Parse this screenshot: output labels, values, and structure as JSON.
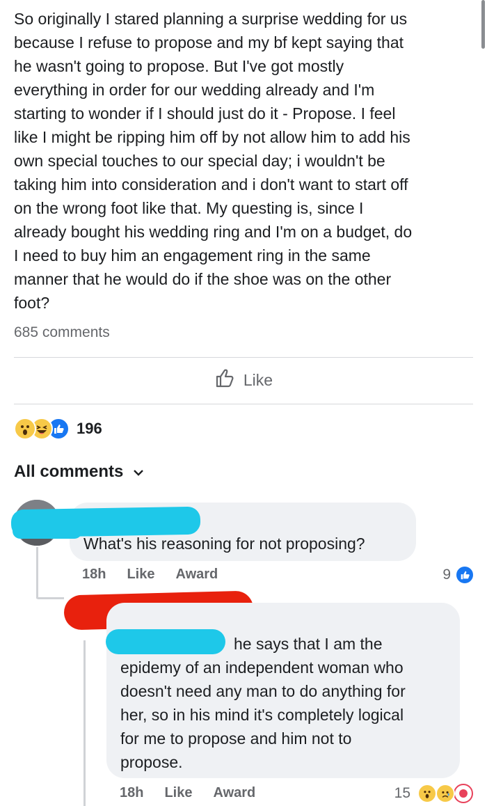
{
  "post": {
    "lines": [
      "So originally I stared planning a surprise wedding for us",
      "because I refuse to propose and my bf kept saying that",
      "he wasn't going to propose. But I've got mostly",
      "everything in order for our wedding already and I'm",
      "starting to wonder if I should just do it - Propose. I feel",
      "like I might be ripping him off by not allow him to add his",
      "own special touches to our special day; i wouldn't be",
      "taking him into consideration and i don't want to start off",
      "on the wrong foot like that. My questing is, since I",
      "already bought his wedding ring and I'm on a budget, do",
      "I need to buy him an engagement ring in the same",
      "manner that he would do if the shoe was on the other",
      "foot?"
    ],
    "comments_count": "685 comments",
    "like_label": "Like",
    "reactions_count": "196",
    "reaction_icons": [
      "wow-icon",
      "haha-icon",
      "like-icon"
    ]
  },
  "comments_header": "All comments",
  "comment1": {
    "text": "What's his reasoning for not proposing?",
    "time": "18h",
    "like": "Like",
    "award": "Award",
    "reaction_count": "9"
  },
  "reply1": {
    "lines": [
      "he says that I am the",
      "epidemy of an independent woman who",
      "doesn't need any man to do anything for",
      "her, so in his mind it's completely logical",
      "for me to propose and him not to",
      "propose."
    ],
    "time": "18h",
    "like": "Like",
    "award": "Award",
    "reaction_count": "15"
  },
  "colors": {
    "redaction_blue": "#1ec8e9",
    "redaction_red": "#e8210d",
    "like_blue": "#1877f2",
    "bubble_bg": "#eff1f4"
  }
}
